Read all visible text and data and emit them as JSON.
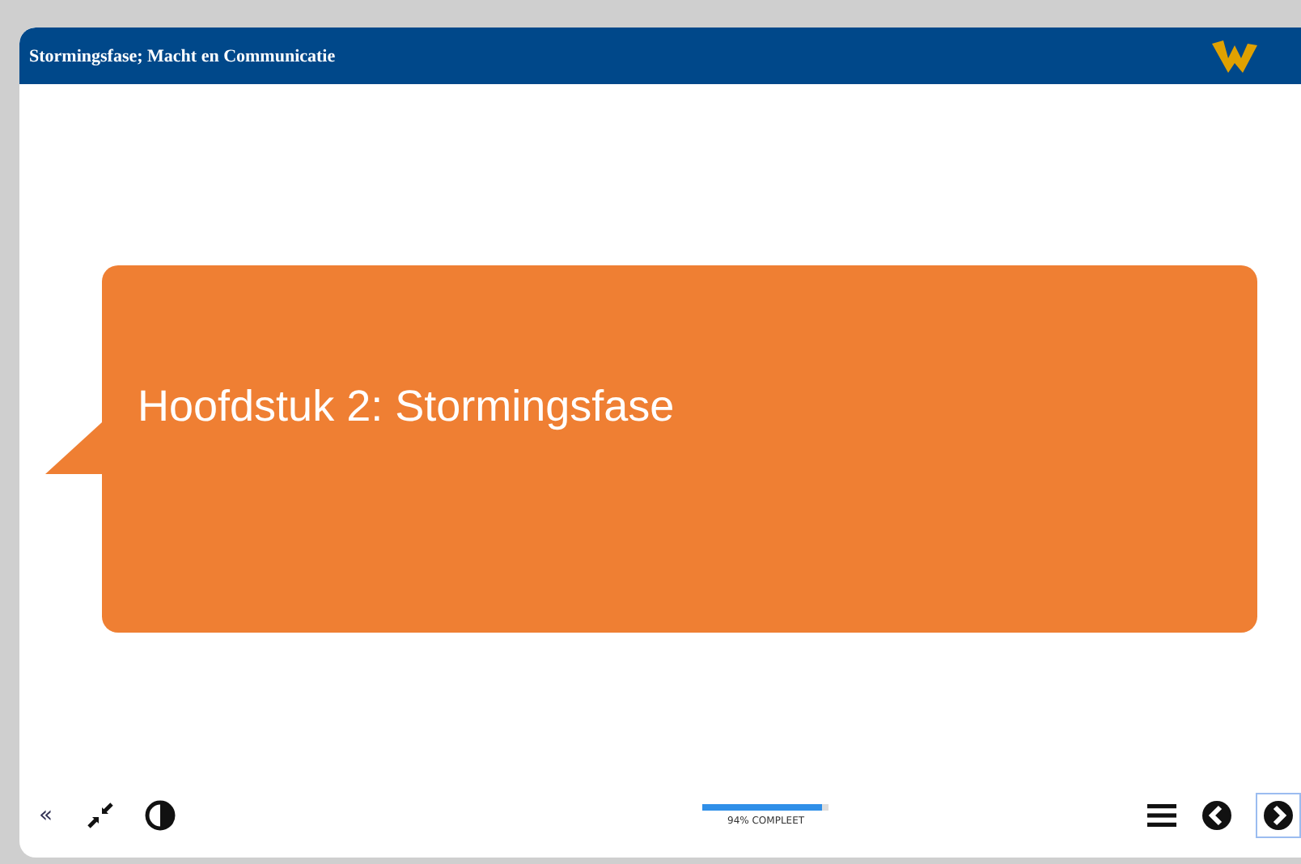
{
  "header": {
    "title": "Stormingsfase; Macht en Communicatie"
  },
  "slide": {
    "heading": "Hoofdstuk 2: Stormingsfase"
  },
  "toolbar": {
    "collapse": "«",
    "progress": {
      "level": 0.94,
      "label": "94% COMPLEET"
    },
    "next_focused": true
  }
}
